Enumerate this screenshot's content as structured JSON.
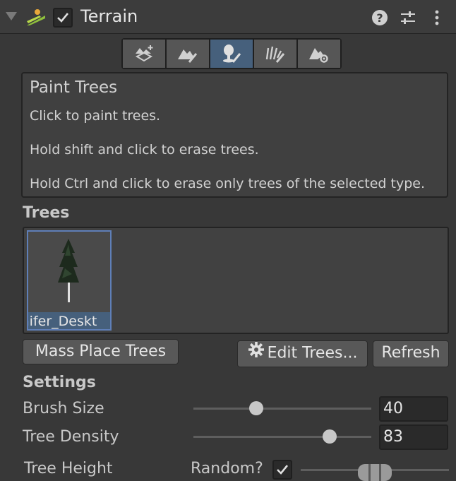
{
  "header": {
    "title": "Terrain",
    "enabled": true,
    "icons": [
      "terrain-icon",
      "help-icon",
      "settings-sliders-icon",
      "more-vertical-icon"
    ]
  },
  "toolbar": {
    "tools": [
      {
        "name": "create-neighbor-terrains-icon",
        "selected": false
      },
      {
        "name": "paint-terrain-icon",
        "selected": false
      },
      {
        "name": "paint-trees-icon",
        "selected": true
      },
      {
        "name": "paint-details-icon",
        "selected": false
      },
      {
        "name": "terrain-settings-icon",
        "selected": false
      }
    ]
  },
  "help": {
    "title": "Paint Trees",
    "line1": "Click to paint trees.",
    "line2": "Hold shift and click to erase trees.",
    "line3": "Hold Ctrl and click to erase only trees of the selected type."
  },
  "trees": {
    "label": "Trees",
    "items": [
      {
        "name": "Conifer_Desktop",
        "visible_label": "onifer_Deskt"
      }
    ]
  },
  "buttons": {
    "mass_place": "Mass Place Trees",
    "edit_trees": "Edit Trees...",
    "refresh": "Refresh"
  },
  "settings": {
    "label": "Settings",
    "brush_size": {
      "label": "Brush Size",
      "value": "40",
      "fraction": 0.34
    },
    "tree_density": {
      "label": "Tree Density",
      "value": "83",
      "fraction": 0.79
    },
    "tree_height": {
      "label": "Tree Height",
      "random_label": "Random?",
      "random_checked": true
    }
  },
  "colors": {
    "background": "#383838",
    "selected": "#46607c",
    "selection_border": "#5f7fb8"
  }
}
